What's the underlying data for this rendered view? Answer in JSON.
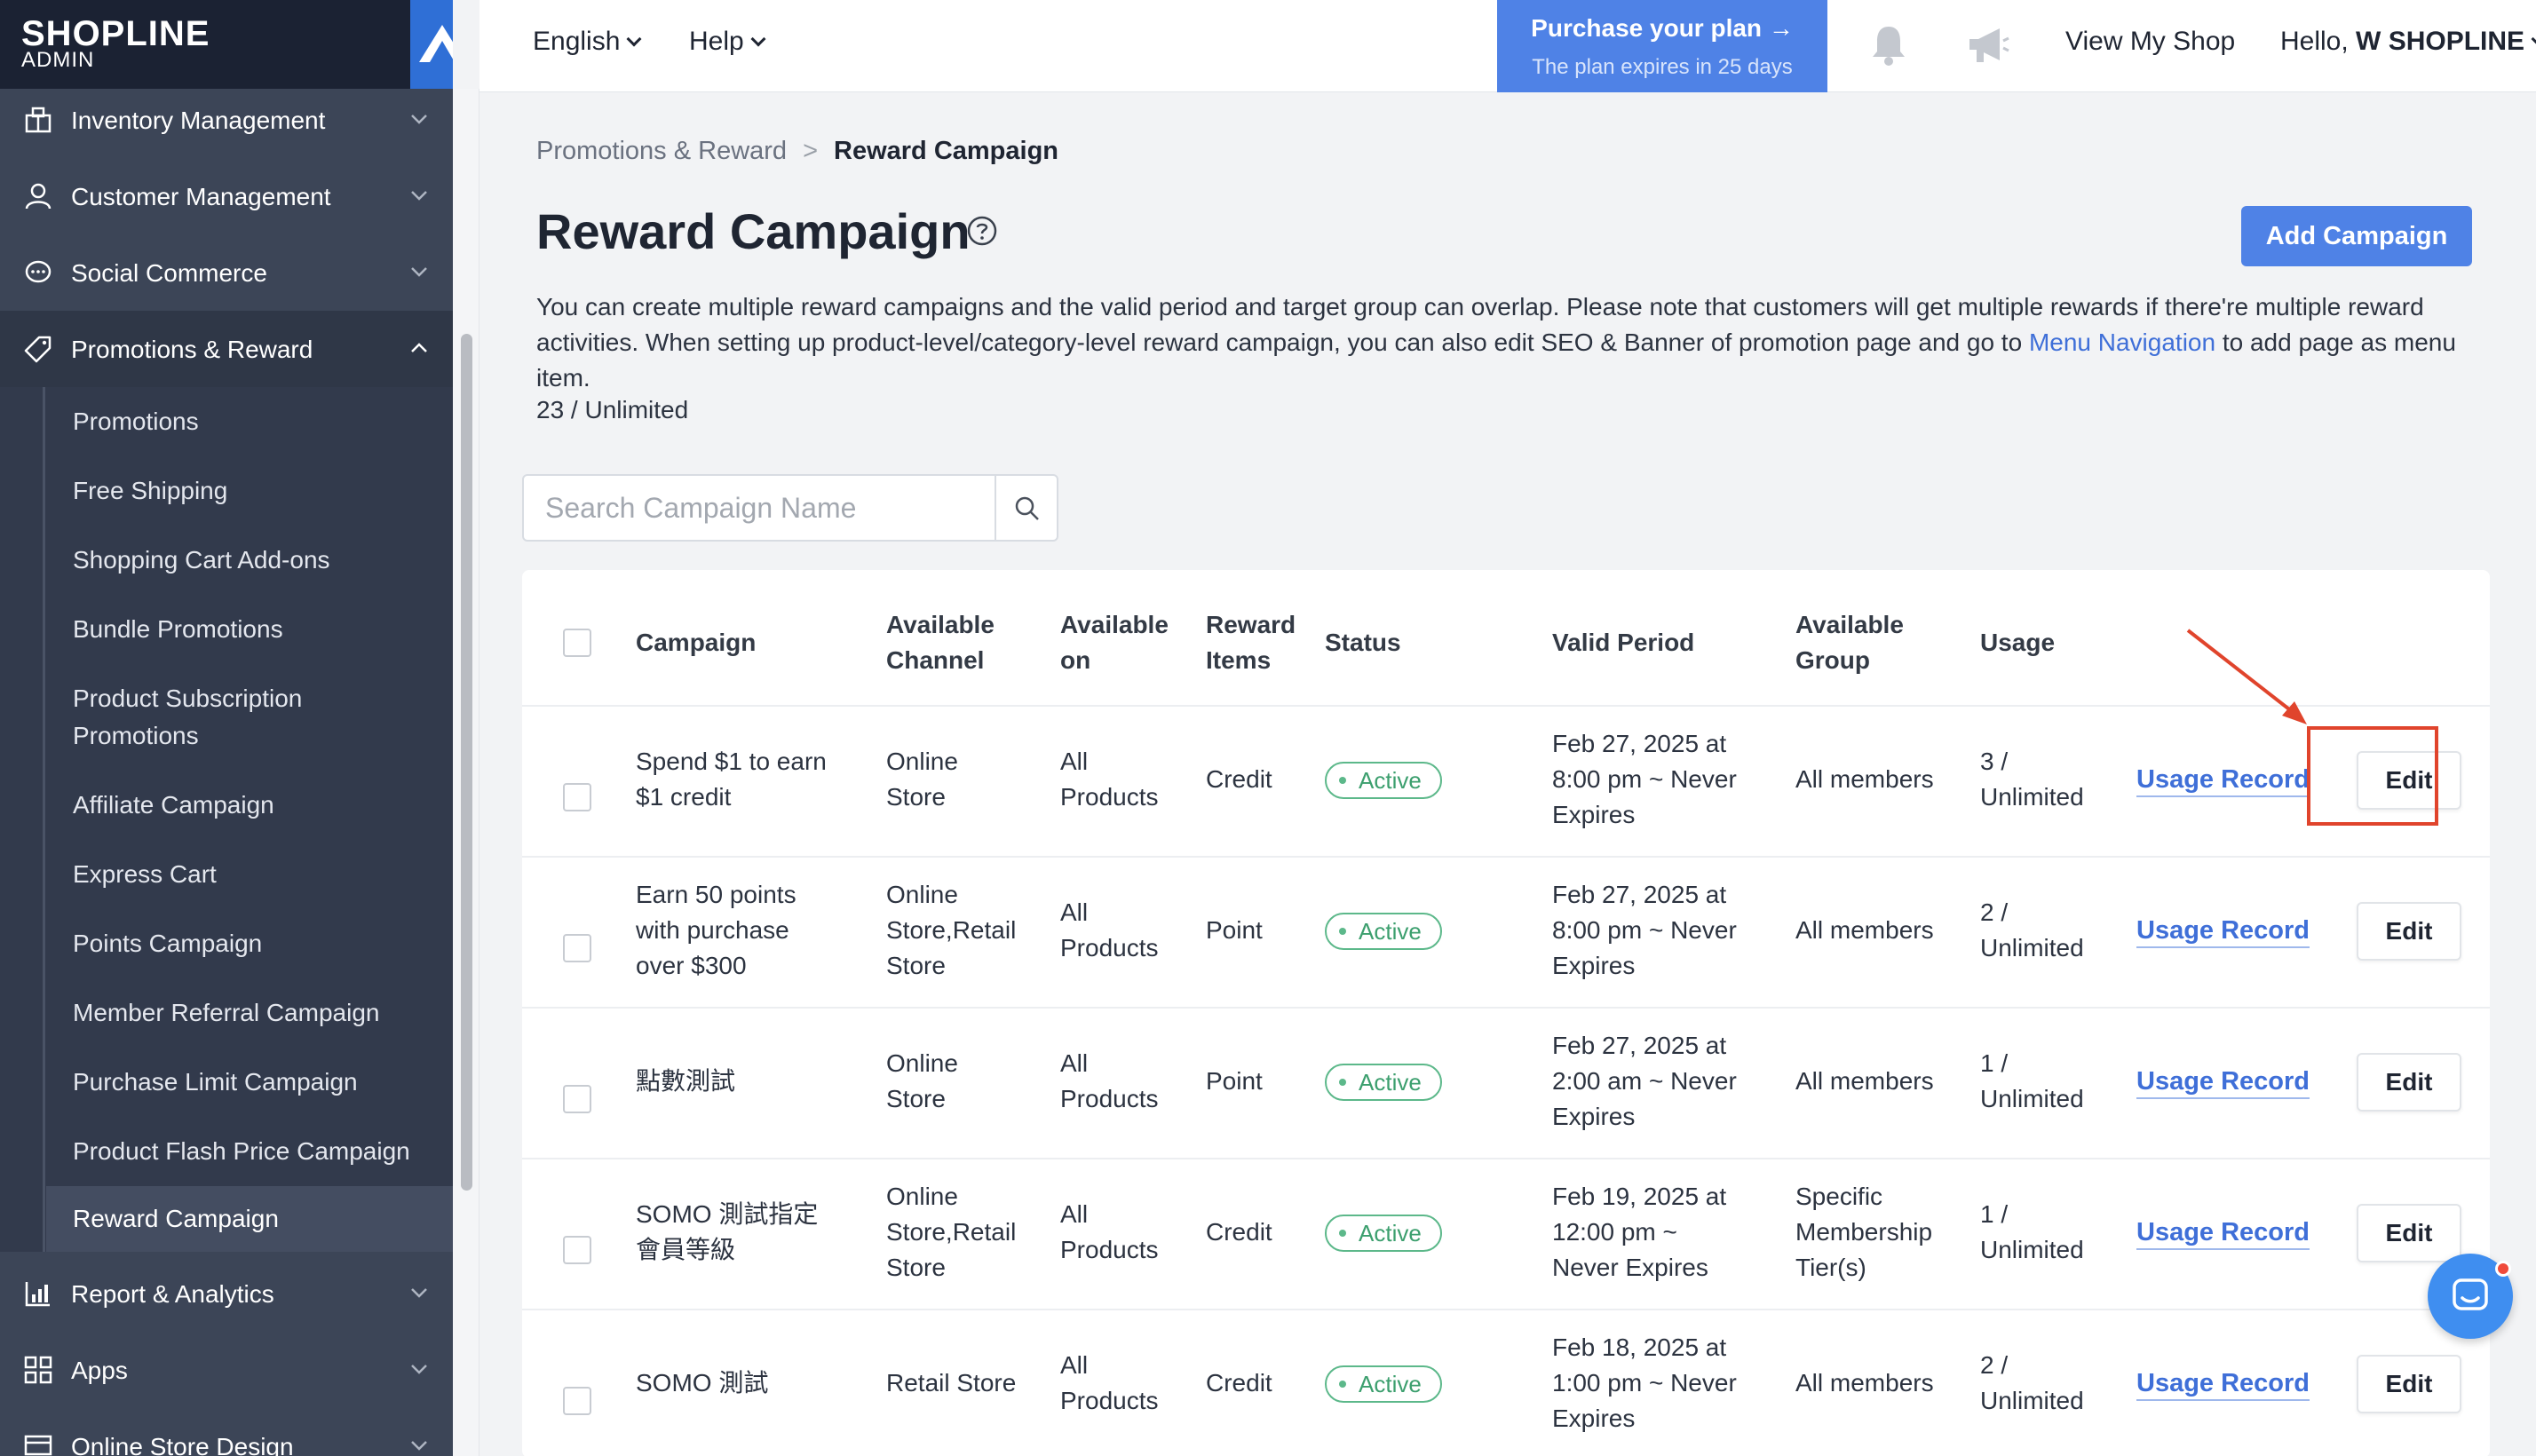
{
  "brand": {
    "name": "SHOPLINE",
    "sub": "ADMIN"
  },
  "sidebar": {
    "top_items": [
      {
        "label": "Inventory Management",
        "icon": "warehouse-icon"
      },
      {
        "label": "Customer Management",
        "icon": "user-icon"
      },
      {
        "label": "Social Commerce",
        "icon": "chat-icon"
      },
      {
        "label": "Promotions & Reward",
        "icon": "tag-icon"
      }
    ],
    "sub_items": [
      "Promotions",
      "Free Shipping",
      "Shopping Cart Add-ons",
      "Bundle Promotions",
      "Product Subscription",
      "Promotions",
      "Affiliate Campaign",
      "Express Cart",
      "Points Campaign",
      "Member Referral Campaign",
      "Purchase Limit Campaign",
      "Product Flash Price Campaign",
      "Reward Campaign"
    ],
    "bottom_items": [
      {
        "label": "Report & Analytics",
        "icon": "chart-icon"
      },
      {
        "label": "Apps",
        "icon": "apps-icon"
      },
      {
        "label": "Online Store Design",
        "icon": "store-design-icon"
      }
    ]
  },
  "header": {
    "language": "English",
    "help": "Help",
    "plan_title": "Purchase your plan →",
    "plan_sub": "The plan expires in 25 days",
    "view_shop": "View My Shop",
    "greeting": "Hello,",
    "user": "W SHOPLINE"
  },
  "breadcrumb": {
    "parent": "Promotions & Reward",
    "separator": ">",
    "current": "Reward Campaign"
  },
  "page": {
    "title": "Reward Campaign",
    "add_button": "Add Campaign",
    "desc_part1": "You can create multiple reward campaigns and the valid period and target group can overlap. Please note that customers will get multiple rewards if there're multiple reward activities. When setting up product-level/category-level reward campaign, you can also edit SEO & Banner of promotion page and go to ",
    "desc_link": "Menu Navigation",
    "desc_part2": " to add page as menu item.",
    "quota": "23 / Unlimited",
    "search_placeholder": "Search Campaign Name"
  },
  "table": {
    "headers": {
      "campaign": "Campaign",
      "channel_1": "Available",
      "channel_2": "Channel",
      "on_1": "Available",
      "on_2": "on",
      "items_1": "Reward",
      "items_2": "Items",
      "status": "Status",
      "period": "Valid Period",
      "group_1": "Available",
      "group_2": "Group",
      "usage": "Usage"
    },
    "rows": [
      {
        "campaign": [
          "Spend $1 to earn",
          "$1 credit"
        ],
        "channel": [
          "Online",
          "Store"
        ],
        "on": [
          "All",
          "Products"
        ],
        "items": "Credit",
        "status": "Active",
        "period": [
          "Feb 27, 2025 at",
          "8:00 pm ~ Never",
          "Expires"
        ],
        "group": [
          "All members"
        ],
        "usage": [
          "3 /",
          "Unlimited"
        ],
        "record": "Usage Record",
        "edit": "Edit"
      },
      {
        "campaign": [
          "Earn 50 points",
          "with purchase",
          "over $300"
        ],
        "channel": [
          "Online",
          "Store,Retail",
          "Store"
        ],
        "on": [
          "All",
          "Products"
        ],
        "items": "Point",
        "status": "Active",
        "period": [
          "Feb 27, 2025 at",
          "8:00 pm ~ Never",
          "Expires"
        ],
        "group": [
          "All members"
        ],
        "usage": [
          "2 /",
          "Unlimited"
        ],
        "record": "Usage Record",
        "edit": "Edit"
      },
      {
        "campaign": [
          "點數測試"
        ],
        "channel": [
          "Online",
          "Store"
        ],
        "on": [
          "All",
          "Products"
        ],
        "items": "Point",
        "status": "Active",
        "period": [
          "Feb 27, 2025 at",
          "2:00 am ~ Never",
          "Expires"
        ],
        "group": [
          "All members"
        ],
        "usage": [
          "1 /",
          "Unlimited"
        ],
        "record": "Usage Record",
        "edit": "Edit"
      },
      {
        "campaign": [
          "SOMO 測試指定",
          "會員等級"
        ],
        "channel": [
          "Online",
          "Store,Retail",
          "Store"
        ],
        "on": [
          "All",
          "Products"
        ],
        "items": "Credit",
        "status": "Active",
        "period": [
          "Feb 19, 2025 at",
          "12:00 pm ~",
          "Never Expires"
        ],
        "group": [
          "Specific",
          "Membership",
          "Tier(s)"
        ],
        "usage": [
          "1 /",
          "Unlimited"
        ],
        "record": "Usage Record",
        "edit": "Edit"
      },
      {
        "campaign": [
          "SOMO 測試"
        ],
        "channel": [
          "Retail Store"
        ],
        "on": [
          "All",
          "Products"
        ],
        "items": "Credit",
        "status": "Active",
        "period": [
          "Feb 18, 2025 at",
          "1:00 pm ~ Never",
          "Expires"
        ],
        "group": [
          "All members"
        ],
        "usage": [
          "2 /",
          "Unlimited"
        ],
        "record": "Usage Record",
        "edit": "Edit"
      }
    ]
  },
  "colors": {
    "accent": "#4f82e6",
    "sidebar": "#3c4557",
    "active_green": "#5cb88a",
    "annotation_red": "#e0442c"
  }
}
